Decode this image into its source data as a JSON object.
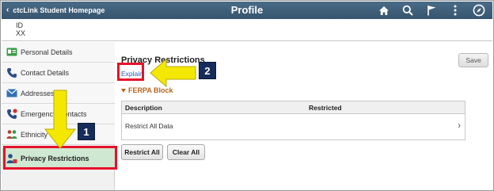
{
  "header": {
    "home_link_label": "ctcLink Student Homepage",
    "page_title": "Profile",
    "icons": [
      "home-icon",
      "search-icon",
      "flag-icon",
      "more-vertical-icon",
      "navbar-compass-icon"
    ]
  },
  "identity": {
    "id_label": "ID",
    "id_value": "XX"
  },
  "sidebar": {
    "items": [
      {
        "label": "Personal Details",
        "icon": "id-card-icon"
      },
      {
        "label": "Contact Details",
        "icon": "phone-icon"
      },
      {
        "label": "Addresses",
        "icon": "envelope-icon"
      },
      {
        "label": "Emergency Contacts",
        "icon": "emergency-phone-icon"
      },
      {
        "label": "Ethnicity",
        "icon": "people-icon"
      },
      {
        "label": "Privacy Restrictions",
        "icon": "privacy-user-icon",
        "active": true
      }
    ]
  },
  "main": {
    "section_title": "Privacy Restrictions",
    "save_label": "Save",
    "explain_label": "Explain",
    "ferpa_label": "FERPA Block",
    "table": {
      "columns": [
        "Description",
        "Restricted"
      ],
      "rows": [
        {
          "description": "Restrict All Data",
          "restricted": ""
        }
      ]
    },
    "buttons": {
      "restrict_all": "Restrict All",
      "clear_all": "Clear All"
    }
  },
  "annotations": {
    "step_1": "1",
    "step_2": "2",
    "highlight_color": "#e8102a",
    "arrow_color": "#f5e800",
    "badge_color": "#162c5a"
  },
  "colors": {
    "banner": "#3f5f7a",
    "ferpa": "#b5651d",
    "link": "#2a5db0",
    "active_nav": "#cfe8d2"
  }
}
